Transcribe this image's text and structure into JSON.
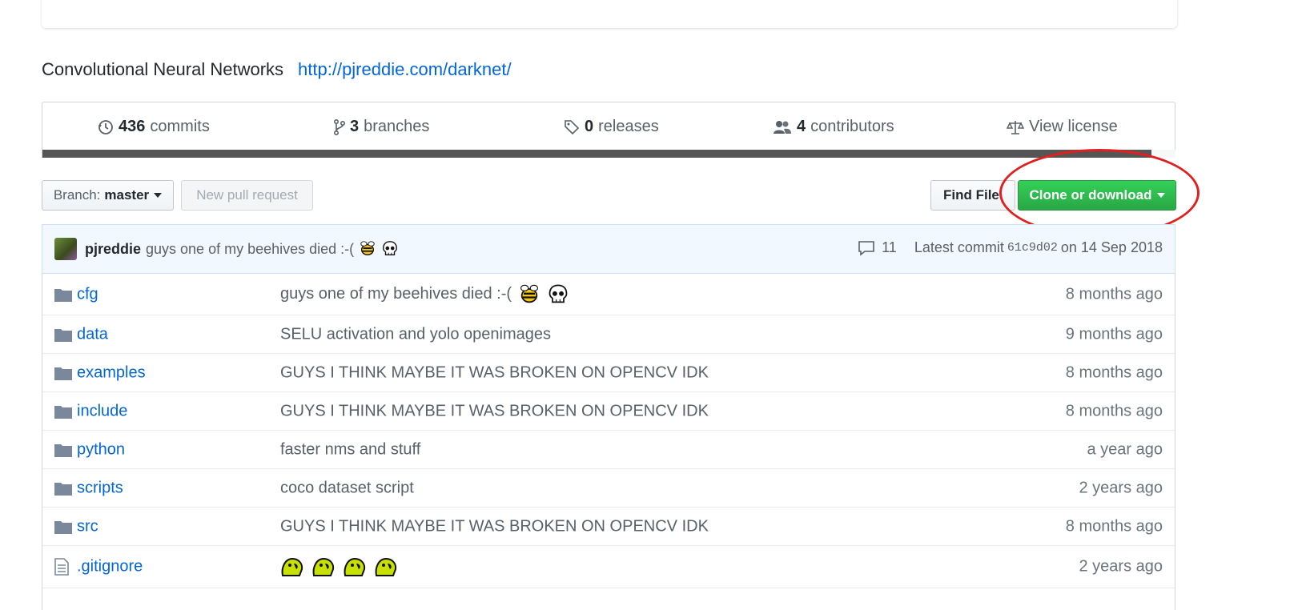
{
  "repo": {
    "description": "Convolutional Neural Networks",
    "homepage": "http://pjreddie.com/darknet/"
  },
  "summary": {
    "commits": {
      "count": "436",
      "label": "commits"
    },
    "branches": {
      "count": "3",
      "label": "branches"
    },
    "releases": {
      "count": "0",
      "label": "releases"
    },
    "contributors": {
      "count": "4",
      "label": "contributors"
    },
    "license": {
      "label": "View license"
    }
  },
  "toolbar": {
    "branch_prefix": "Branch:",
    "branch_name": "master",
    "new_pr": "New pull request",
    "find_file": "Find File",
    "clone": "Clone or download"
  },
  "latest_commit": {
    "author": "pjreddie",
    "message": "guys one of my beehives died :-(",
    "comments": "11",
    "prefix": "Latest commit",
    "sha": "61c9d02",
    "date": "on 14 Sep 2018"
  },
  "files": [
    {
      "name": "cfg",
      "type": "folder",
      "message": "guys one of my beehives died :-(",
      "age": "8 months ago",
      "emoji": "bee-skull"
    },
    {
      "name": "data",
      "type": "folder",
      "message": "SELU activation and yolo openimages",
      "age": "9 months ago"
    },
    {
      "name": "examples",
      "type": "folder",
      "message": "GUYS I THINK MAYBE IT WAS BROKEN ON OPENCV IDK",
      "age": "8 months ago"
    },
    {
      "name": "include",
      "type": "folder",
      "message": "GUYS I THINK MAYBE IT WAS BROKEN ON OPENCV IDK",
      "age": "8 months ago"
    },
    {
      "name": "python",
      "type": "folder",
      "message": "faster nms and stuff",
      "age": "a year ago"
    },
    {
      "name": "scripts",
      "type": "folder",
      "message": "coco dataset script",
      "age": "2 years ago"
    },
    {
      "name": "src",
      "type": "folder",
      "message": "GUYS I THINK MAYBE IT WAS BROKEN ON OPENCV IDK",
      "age": "8 months ago"
    },
    {
      "name": ".gitignore",
      "type": "file",
      "message": "",
      "age": "2 years ago",
      "emoji": "parrots"
    }
  ],
  "colors": {
    "link": "#0366d6",
    "clone_button": "#28a745",
    "annotation": "#e02020",
    "folder_icon": "#79889b"
  }
}
